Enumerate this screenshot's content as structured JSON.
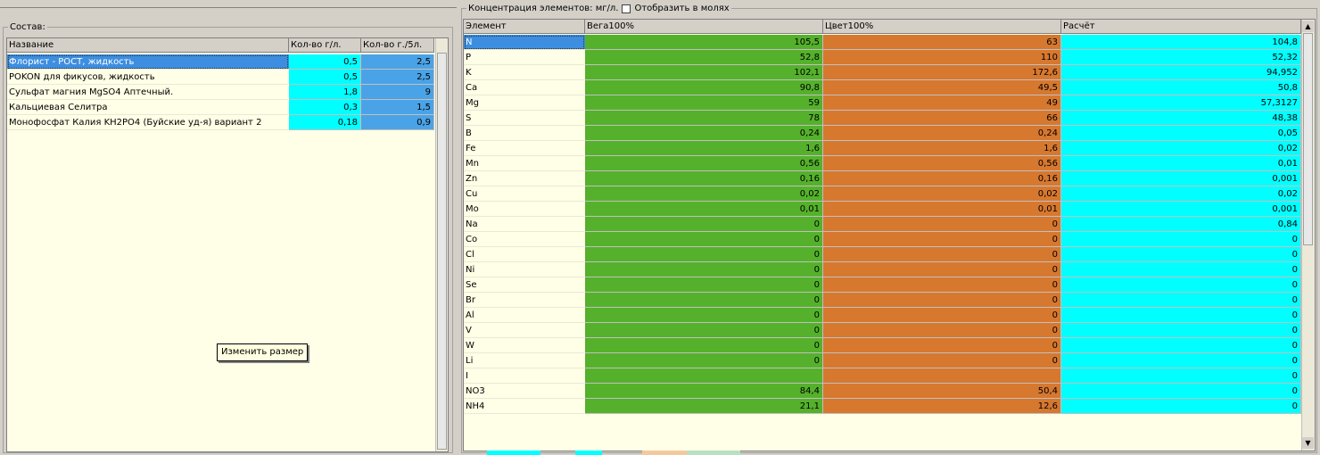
{
  "left": {
    "legend": "Состав:",
    "columns": [
      "Название",
      "Кол-во г/л.",
      "Кол-во г./5л."
    ],
    "rows": [
      {
        "name": "Флорист - РОСТ, жидкость",
        "gpl": "0,5",
        "g5l": "2,5"
      },
      {
        "name": "POKON для фикусов, жидкость",
        "gpl": "0,5",
        "g5l": "2,5"
      },
      {
        "name": "Сульфат магния MgSO4 Аптечный.",
        "gpl": "1,8",
        "g5l": "9"
      },
      {
        "name": "Кальциевая Селитра",
        "gpl": "0,3",
        "g5l": "1,5"
      },
      {
        "name": "Монофосфат Калия KH2PO4 (Буйские уд-я) вариант 2",
        "gpl": "0,18",
        "g5l": "0,9"
      }
    ],
    "tooltip": "Изменить размер"
  },
  "right": {
    "legend": "Концентрация элементов: мг/л.",
    "checkbox_label": "Отобразить в молях",
    "columns": [
      "Элемент",
      "Вега100%",
      "Цвет100%",
      "Расчёт"
    ],
    "rows": [
      {
        "el": "N",
        "a": "105,5",
        "b": "63",
        "c": "104,8"
      },
      {
        "el": "P",
        "a": "52,8",
        "b": "110",
        "c": "52,32"
      },
      {
        "el": "K",
        "a": "102,1",
        "b": "172,6",
        "c": "94,952"
      },
      {
        "el": "Ca",
        "a": "90,8",
        "b": "49,5",
        "c": "50,8"
      },
      {
        "el": "Mg",
        "a": "59",
        "b": "49",
        "c": "57,3127"
      },
      {
        "el": "S",
        "a": "78",
        "b": "66",
        "c": "48,38"
      },
      {
        "el": "B",
        "a": "0,24",
        "b": "0,24",
        "c": "0,05"
      },
      {
        "el": "Fe",
        "a": "1,6",
        "b": "1,6",
        "c": "0,02"
      },
      {
        "el": "Mn",
        "a": "0,56",
        "b": "0,56",
        "c": "0,01"
      },
      {
        "el": "Zn",
        "a": "0,16",
        "b": "0,16",
        "c": "0,001"
      },
      {
        "el": "Cu",
        "a": "0,02",
        "b": "0,02",
        "c": "0,02"
      },
      {
        "el": "Mo",
        "a": "0,01",
        "b": "0,01",
        "c": "0,001"
      },
      {
        "el": "Na",
        "a": "0",
        "b": "0",
        "c": "0,84"
      },
      {
        "el": "Co",
        "a": "0",
        "b": "0",
        "c": "0"
      },
      {
        "el": "Cl",
        "a": "0",
        "b": "0",
        "c": "0"
      },
      {
        "el": "Ni",
        "a": "0",
        "b": "0",
        "c": "0"
      },
      {
        "el": "Se",
        "a": "0",
        "b": "0",
        "c": "0"
      },
      {
        "el": "Br",
        "a": "0",
        "b": "0",
        "c": "0"
      },
      {
        "el": "Al",
        "a": "0",
        "b": "0",
        "c": "0"
      },
      {
        "el": "V",
        "a": "0",
        "b": "0",
        "c": "0"
      },
      {
        "el": "W",
        "a": "0",
        "b": "0",
        "c": "0"
      },
      {
        "el": "Li",
        "a": "0",
        "b": "0",
        "c": "0"
      },
      {
        "el": "I",
        "a": "",
        "b": "",
        "c": "0"
      },
      {
        "el": "NO3",
        "a": "84,4",
        "b": "50,4",
        "c": "0"
      },
      {
        "el": "NH4",
        "a": "21,1",
        "b": "12,6",
        "c": "0"
      }
    ]
  },
  "colors": {
    "grid_bg": "#fffee6",
    "selection": "#3d8ee0",
    "cyan": "#00ffff",
    "blue": "#4aa3e6",
    "green": "#55b12b",
    "orange": "#d7782f"
  }
}
